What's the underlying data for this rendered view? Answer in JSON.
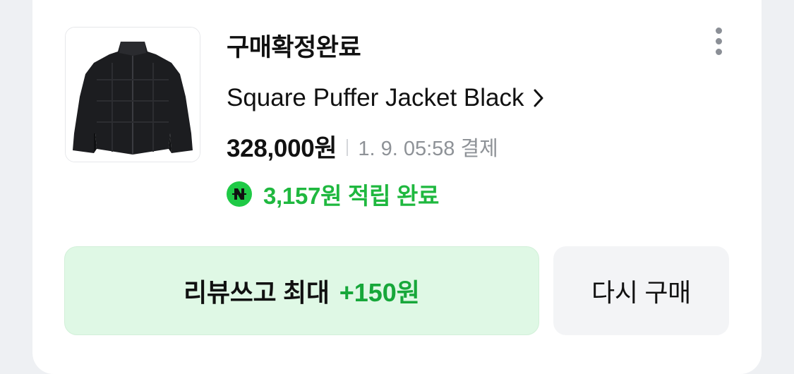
{
  "order": {
    "status": "구매확정완료",
    "product_name": "Square Puffer Jacket Black",
    "price": "328,000원",
    "paid_info": "1. 9. 05:58 결제",
    "points": "3,157원 적립 완료",
    "points_badge_letter": "N"
  },
  "actions": {
    "review_label": "리뷰쓰고 최대",
    "review_bonus": "+150원",
    "rebuy_label": "다시 구매"
  },
  "icons": {
    "more": "more-vertical-icon",
    "chevron": "chevron-right-icon",
    "points_badge": "naver-pay-icon"
  },
  "colors": {
    "accent_green": "#1fca46",
    "review_button_bg": "#dff8e5",
    "rebuy_button_bg": "#f3f4f6"
  }
}
